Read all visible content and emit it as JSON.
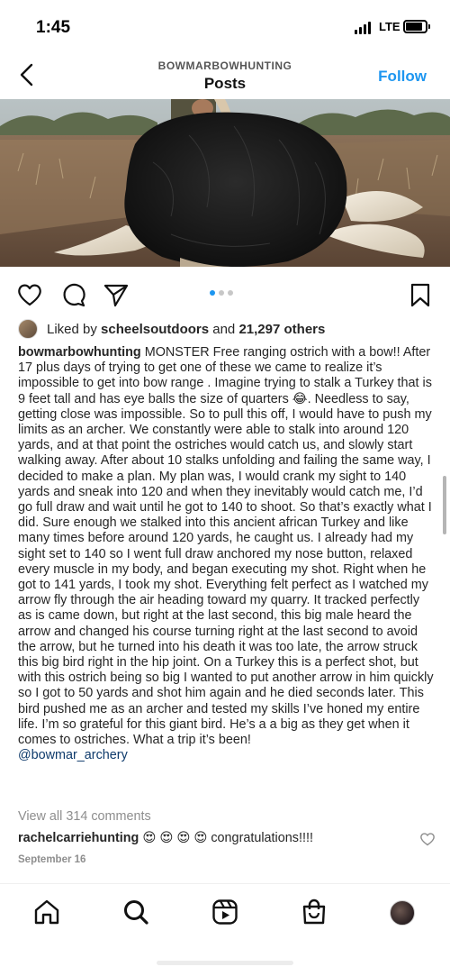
{
  "status": {
    "time": "1:45",
    "network": "LTE"
  },
  "header": {
    "username": "BOWMARBOWHUNTING",
    "title": "Posts",
    "follow_label": "Follow"
  },
  "icons": {
    "back": "chevron-left-icon",
    "like": "heart-icon",
    "comment": "comment-icon",
    "share": "paper-plane-icon",
    "save": "bookmark-icon",
    "home": "home-icon",
    "search": "search-icon",
    "reels": "reels-icon",
    "shop": "shopping-bag-icon",
    "profile": "profile-avatar"
  },
  "carousel": {
    "count": 3,
    "active": 1
  },
  "likes": {
    "prefix": "Liked by ",
    "user": "scheelsoutdoors",
    "middle": " and ",
    "count": "21,297 others"
  },
  "caption": {
    "user": "bowmarbowhunting",
    "text": " MONSTER Free ranging ostrich with a bow!! After 17 plus days of trying to get one of these we came to realize it’s impossible to get into bow range . Imagine trying to stalk a Turkey that is 9 feet tall and has eye balls the size of quarters 😂. Needless to say, getting close was impossible. So to pull this off, I would have to  push my limits as an archer. We constantly were able to stalk into around 120 yards, and at that point the ostriches would catch us, and slowly start walking away. After about 10 stalks unfolding and failing the same way, I decided to make a plan. My plan was, I would crank my sight to 140 yards and sneak into 120 and when they inevitably would catch me, I’d go full draw and wait until he got to 140 to shoot. So that’s exactly what I did. Sure enough we stalked into this ancient african Turkey and like many times before around 120 yards, he caught us. I already had my sight set to 140 so I went full draw anchored my nose button, relaxed every muscle in my body, and began executing my shot. Right when he got to 141 yards, I took my shot. Everything felt perfect as I watched my arrow fly through the air heading toward my quarry. It tracked perfectly as is came down, but right at the last second, this big male heard the arrow and changed his course turning right at the last second to avoid the arrow, but he turned into his death it was too late, the arrow struck this big bird right in the hip joint. On a Turkey this is a perfect shot, but with this ostrich being so big I wanted to put another arrow in him quickly so I got to 50 yards and shot him again and he died seconds later. This bird pushed me as an archer and tested my skills I’ve honed my entire life. I’m so grateful for this giant bird. He’s a a big as they get when it comes to ostriches. What a trip it’s been!",
    "mention": "@bowmar_archery"
  },
  "comments": {
    "view_all": "View all 314 comments",
    "top": {
      "user": "rachelcarriehunting",
      "text": " 😍 😍 😍 😍 congratulations!!!!"
    }
  },
  "date": "September 16",
  "colors": {
    "accent": "#1d96f0",
    "mention": "#0e3a6b",
    "muted": "#8e8e8e"
  }
}
